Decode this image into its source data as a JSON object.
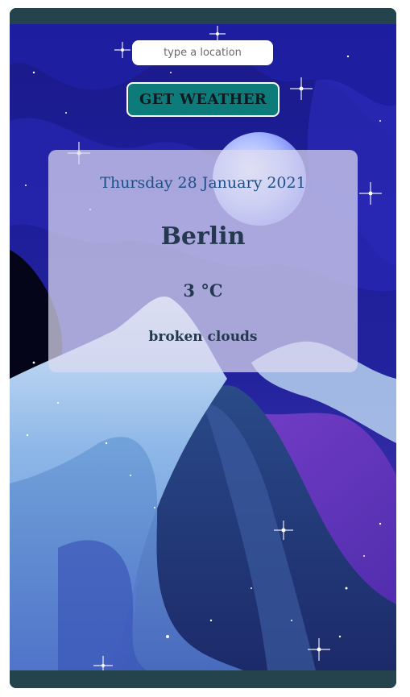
{
  "search": {
    "placeholder": "type a location",
    "value": ""
  },
  "actions": {
    "get_weather_label": "GET WEATHER"
  },
  "weather": {
    "date": "Thursday 28 January 2021",
    "city": "Berlin",
    "temperature": "3 °C",
    "description": "broken clouds"
  },
  "colors": {
    "frame": "#24434d",
    "button": "#0e7b7b",
    "sky": "#1e1e9a",
    "card": "rgba(220,218,240,0.72)"
  }
}
